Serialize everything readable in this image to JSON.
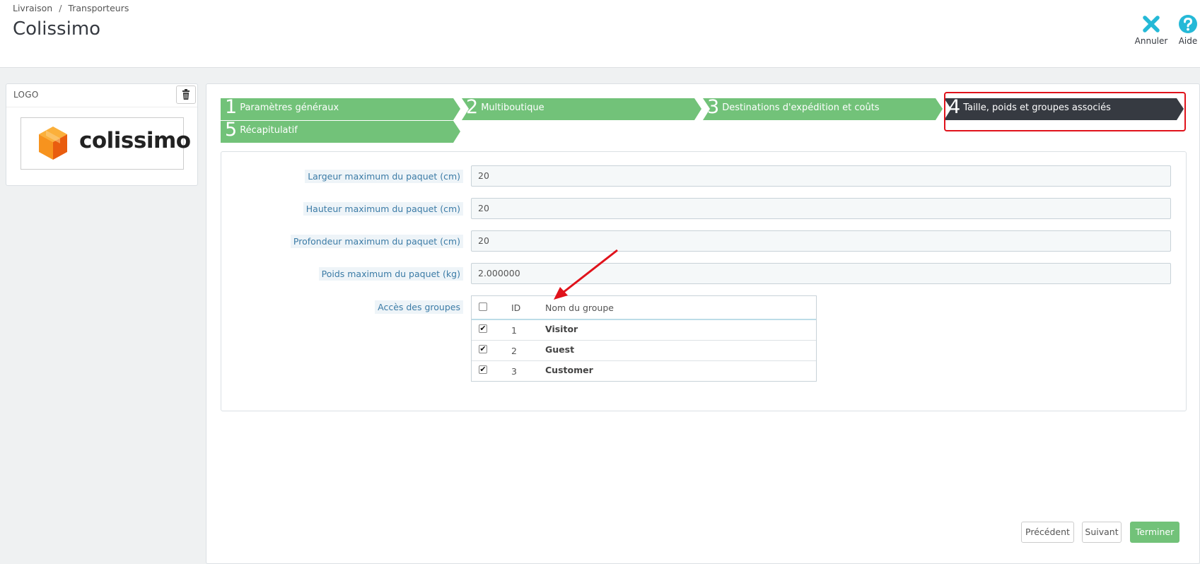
{
  "breadcrumb": {
    "items": [
      "Livraison",
      "Transporteurs"
    ],
    "separator": "/"
  },
  "page": {
    "title": "Colissimo"
  },
  "toolbar": {
    "cancel_label": "Annuler",
    "cancel_icon": "close-icon",
    "help_label": "Aide",
    "help_icon": "help-icon"
  },
  "logo_panel": {
    "title": "LOGO",
    "logo_text": "colissimo",
    "delete_icon": "trash-icon"
  },
  "steps": [
    {
      "num": "1",
      "label": "Paramètres généraux",
      "state": "done"
    },
    {
      "num": "2",
      "label": "Multiboutique",
      "state": "done"
    },
    {
      "num": "3",
      "label": "Destinations d'expédition et coûts",
      "state": "done"
    },
    {
      "num": "4",
      "label": "Taille, poids et groupes associés",
      "state": "current"
    },
    {
      "num": "5",
      "label": "Récapitulatif",
      "state": "done"
    }
  ],
  "form": {
    "fields": [
      {
        "label": "Largeur maximum du paquet (cm)",
        "value": "20"
      },
      {
        "label": "Hauteur maximum du paquet (cm)",
        "value": "20"
      },
      {
        "label": "Profondeur maximum du paquet (cm)",
        "value": "20"
      },
      {
        "label": "Poids maximum du paquet (kg)",
        "value": "2.000000"
      }
    ],
    "groups_label": "Accès des groupes",
    "groups_table": {
      "columns": [
        "ID",
        "Nom du groupe"
      ],
      "select_all_checked": false,
      "rows": [
        {
          "id": "1",
          "name": "Visitor",
          "checked": true
        },
        {
          "id": "2",
          "name": "Guest",
          "checked": true
        },
        {
          "id": "3",
          "name": "Customer",
          "checked": true
        }
      ]
    }
  },
  "buttons": {
    "previous": "Précédent",
    "next": "Suivant",
    "finish": "Terminer"
  },
  "colors": {
    "step_done": "#72c279",
    "step_current": "#363a41",
    "highlight": "#e0121b",
    "accent": "#25b9d7",
    "annotation_arrow": "#e0121b"
  }
}
